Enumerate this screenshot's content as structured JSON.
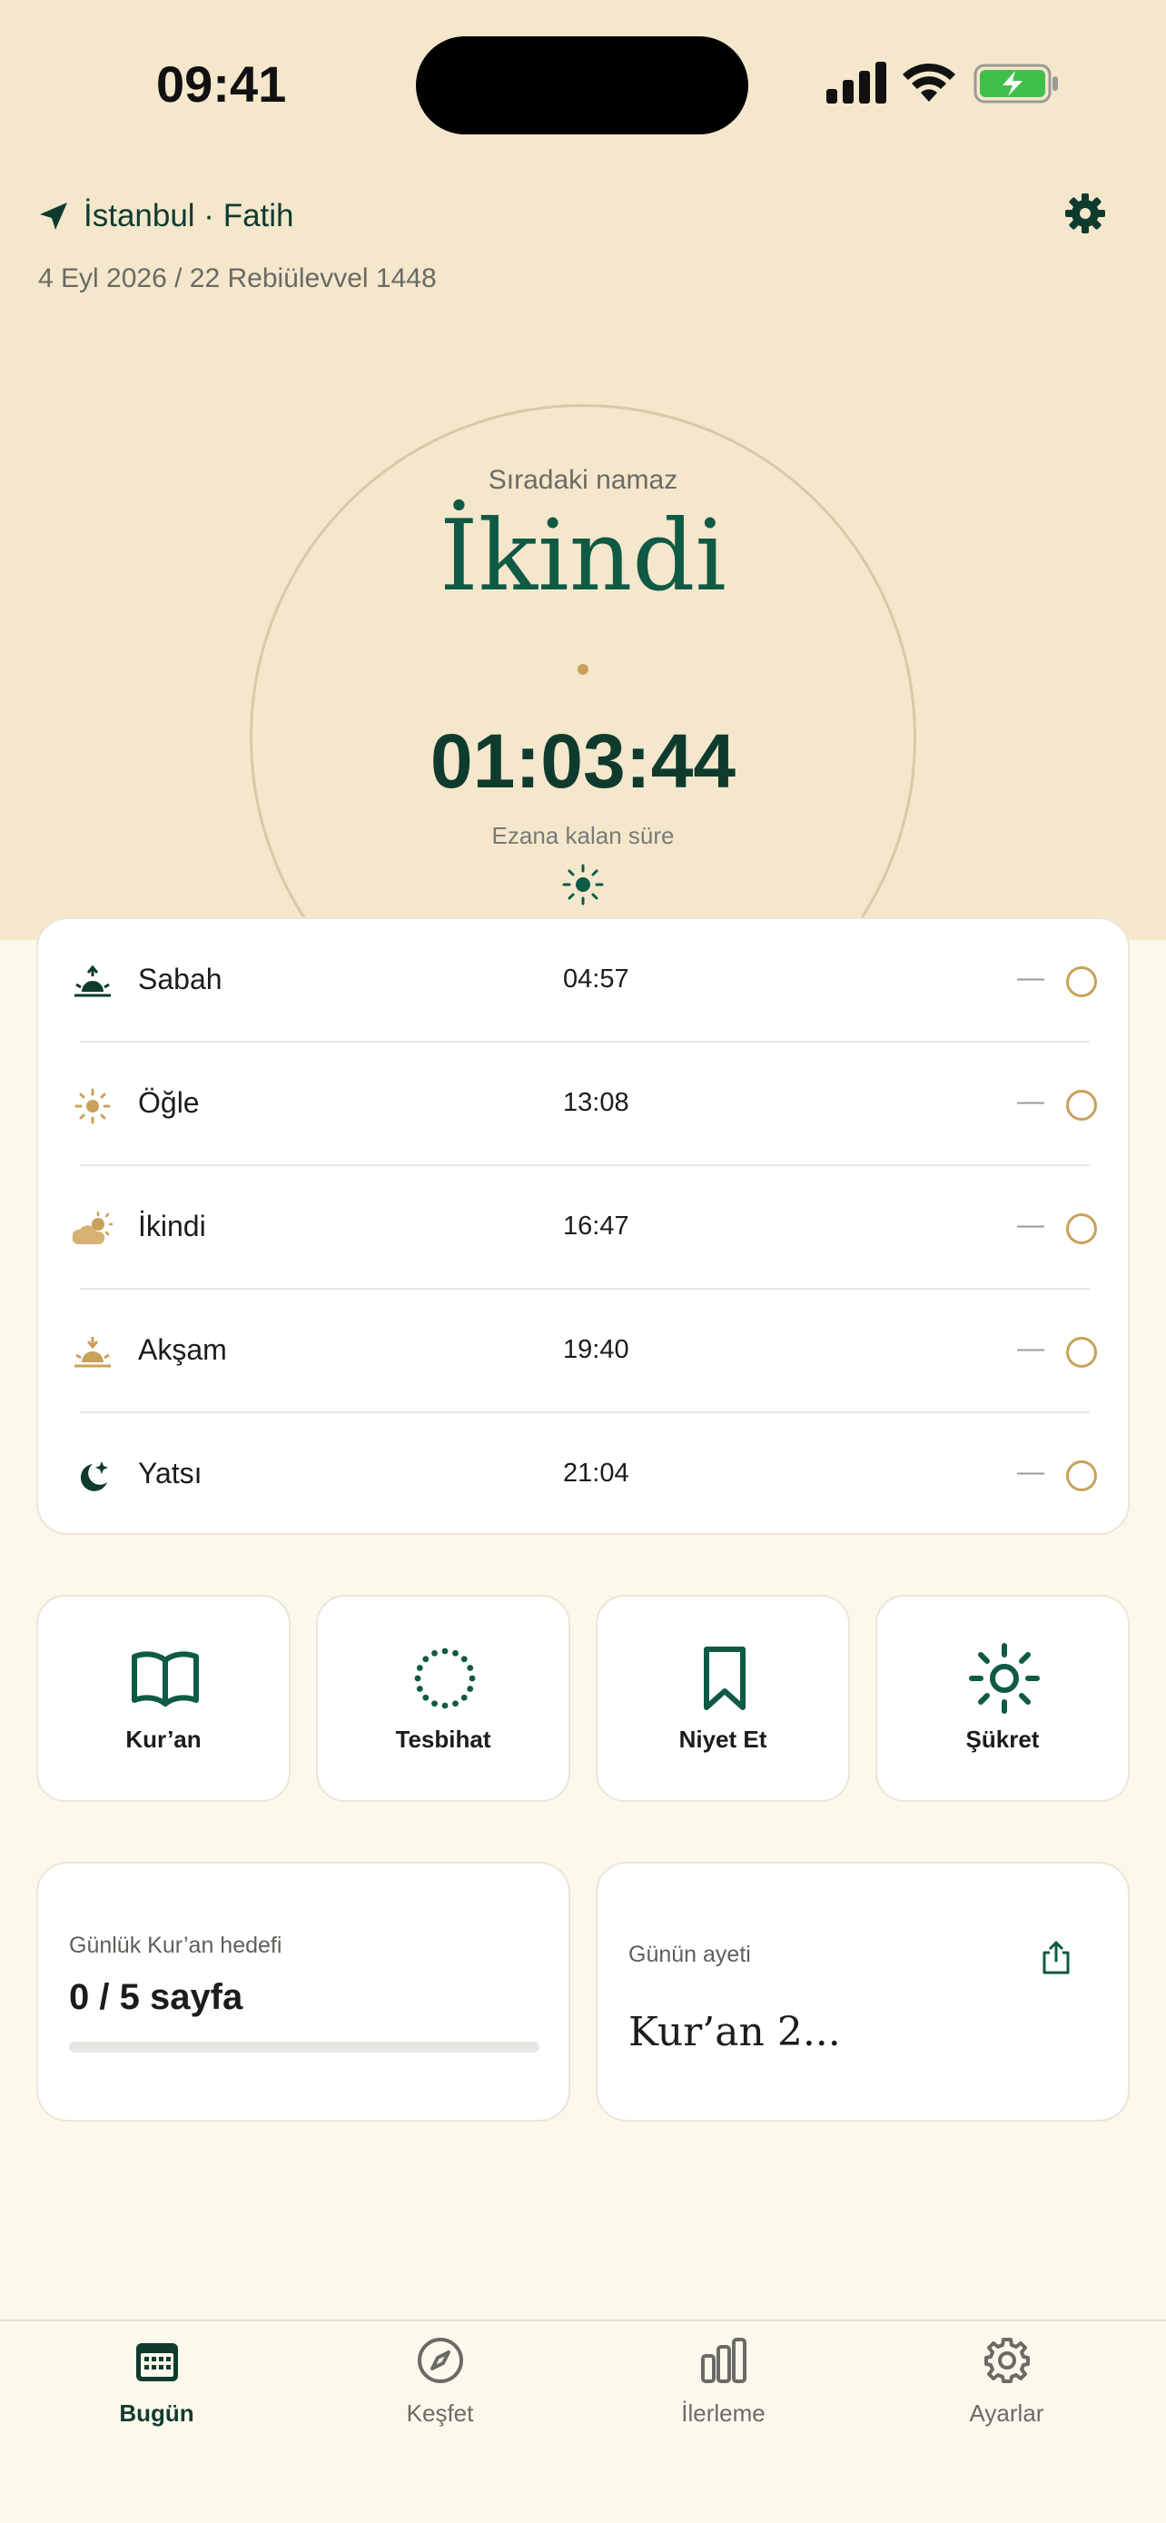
{
  "status_bar": {
    "time": "09:41"
  },
  "header": {
    "location": "İstanbul · Fatih",
    "date": "4 Eyl 2026 / 22 Rebiülevvel 1448"
  },
  "next_prayer": {
    "label": "Sıradaki namaz",
    "name": "İkindi",
    "countdown": "01:03:44",
    "countdown_label": "Ezana kalan süre"
  },
  "prayers": [
    {
      "name": "Sabah",
      "time": "04:57",
      "status": "—",
      "icon": "sunrise-icon",
      "done": false
    },
    {
      "name": "Öğle",
      "time": "13:08",
      "status": "—",
      "icon": "sun-icon",
      "done": false
    },
    {
      "name": "İkindi",
      "time": "16:47",
      "status": "—",
      "icon": "cloud-sun-icon",
      "done": false
    },
    {
      "name": "Akşam",
      "time": "19:40",
      "status": "—",
      "icon": "sunset-icon",
      "done": false
    },
    {
      "name": "Yatsı",
      "time": "21:04",
      "status": "—",
      "icon": "moon-star-icon",
      "done": false
    }
  ],
  "quick_actions": [
    {
      "label": "Kur’an",
      "icon": "book-icon"
    },
    {
      "label": "Tesbihat",
      "icon": "prayer-beads-icon"
    },
    {
      "label": "Niyet Et",
      "icon": "bookmark-icon"
    },
    {
      "label": "Şükret",
      "icon": "sun-icon"
    }
  ],
  "daily_goal": {
    "label": "Günlük Kur’an hedefi",
    "value": "0 / 5 sayfa",
    "progress_fraction": 0
  },
  "verse": {
    "label": "Günün ayeti",
    "text": "Kur’an 2..."
  },
  "tabs": [
    {
      "label": "Bugün",
      "icon": "calendar-icon",
      "active": true
    },
    {
      "label": "Keşfet",
      "icon": "compass-icon",
      "active": false
    },
    {
      "label": "İlerleme",
      "icon": "bar-chart-icon",
      "active": false
    },
    {
      "label": "Ayarlar",
      "icon": "gear-icon",
      "active": false
    }
  ],
  "colors": {
    "primary": "#0f3b2e",
    "accent_green": "#0f5a45",
    "accent_gold": "#c9a15a",
    "hero_bg": "#f4e7cc",
    "page_bg": "#fdf8ec"
  }
}
